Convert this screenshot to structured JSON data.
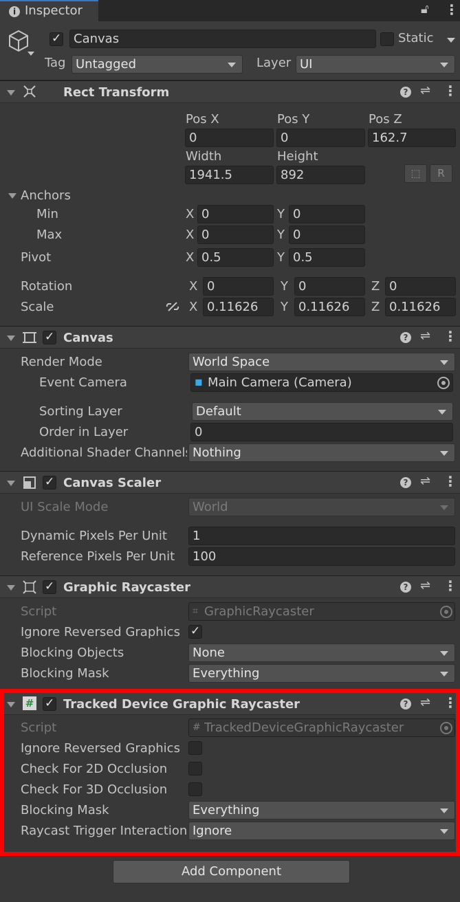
{
  "tab": {
    "title": "Inspector"
  },
  "object": {
    "name": "Canvas",
    "static_label": "Static",
    "tag_label": "Tag",
    "tag_value": "Untagged",
    "layer_label": "Layer",
    "layer_value": "UI"
  },
  "rect_transform": {
    "title": "Rect Transform",
    "pos_x_label": "Pos X",
    "pos_y_label": "Pos Y",
    "pos_z_label": "Pos Z",
    "pos_x": "0",
    "pos_y": "0",
    "pos_z": "162.7",
    "width_label": "Width",
    "height_label": "Height",
    "width": "1941.5",
    "height": "892",
    "raw_button": "R",
    "anchors_label": "Anchors",
    "min_label": "Min",
    "max_label": "Max",
    "min_x": "0",
    "min_y": "0",
    "max_x": "0",
    "max_y": "0",
    "pivot_label": "Pivot",
    "pivot_x": "0.5",
    "pivot_y": "0.5",
    "rotation_label": "Rotation",
    "rot_x": "0",
    "rot_y": "0",
    "rot_z": "0",
    "scale_label": "Scale",
    "scale_x": "0.11626",
    "scale_y": "0.11626",
    "scale_z": "0.11626",
    "x": "X",
    "y": "Y",
    "z": "Z"
  },
  "canvas": {
    "title": "Canvas",
    "render_mode_label": "Render Mode",
    "render_mode": "World Space",
    "event_camera_label": "Event Camera",
    "event_camera": "Main Camera (Camera)",
    "sorting_layer_label": "Sorting Layer",
    "sorting_layer": "Default",
    "order_label": "Order in Layer",
    "order": "0",
    "shader_label": "Additional Shader Channels",
    "shader": "Nothing"
  },
  "canvas_scaler": {
    "title": "Canvas Scaler",
    "ui_scale_label": "UI Scale Mode",
    "ui_scale": "World",
    "dynamic_label": "Dynamic Pixels Per Unit",
    "dynamic": "1",
    "reference_label": "Reference Pixels Per Unit",
    "reference": "100"
  },
  "graphic_raycaster": {
    "title": "Graphic Raycaster",
    "script_label": "Script",
    "script": "GraphicRaycaster",
    "ignore_label": "Ignore Reversed Graphics",
    "blocking_objects_label": "Blocking Objects",
    "blocking_objects": "None",
    "blocking_mask_label": "Blocking Mask",
    "blocking_mask": "Everything"
  },
  "tracked_raycaster": {
    "title": "Tracked Device Graphic Raycaster",
    "script_label": "Script",
    "script": "TrackedDeviceGraphicRaycaster",
    "ignore_label": "Ignore Reversed Graphics",
    "check2d_label": "Check For 2D Occlusion",
    "check3d_label": "Check For 3D Occlusion",
    "blocking_mask_label": "Blocking Mask",
    "blocking_mask": "Everything",
    "trigger_label": "Raycast Trigger Interaction",
    "trigger": "Ignore"
  },
  "add_component": "Add Component",
  "colors": {
    "highlight": "#ff0000",
    "accent": "#3a79bb"
  }
}
